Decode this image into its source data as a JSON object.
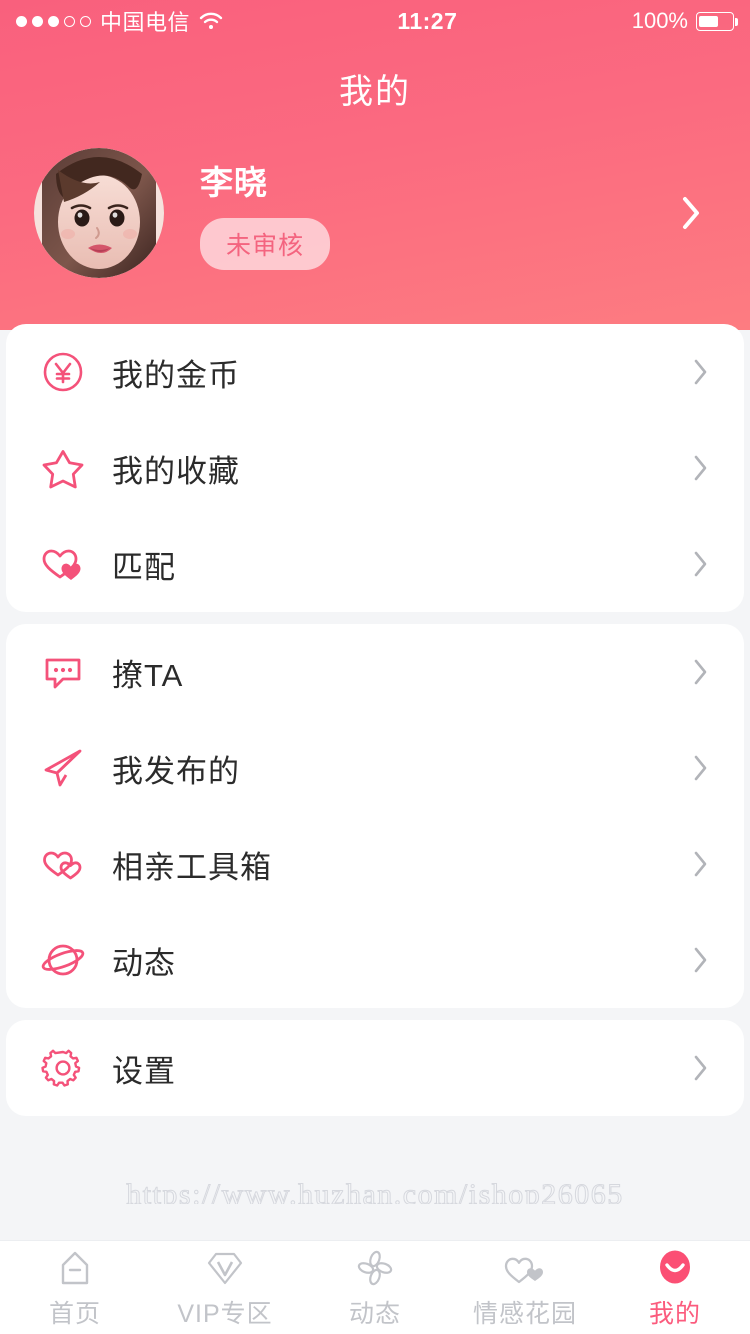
{
  "theme": {
    "header_gradient_top": "#f9607d",
    "header_gradient_bottom": "#fd7c81",
    "accent_pink": "#f4527a",
    "tab_active_pink": "#fb5b7d",
    "tab_inactive_gray": "#c2c4c9",
    "card_bg": "#ffffff",
    "page_bg": "#f4f5f7"
  },
  "status_bar": {
    "signal_dots": [
      "filled",
      "filled",
      "filled",
      "hollow",
      "hollow"
    ],
    "carrier": "中国电信",
    "wifi_icon": "wifi-icon",
    "time": "11:27",
    "battery_percent": "100%",
    "battery_icon": "battery-full-icon"
  },
  "header": {
    "title": "我的",
    "profile": {
      "avatar_icon": "avatar",
      "name": "李晓",
      "badge": "未审核",
      "chevron_icon": "chevron-right-icon"
    }
  },
  "menu_groups": [
    {
      "group_name": "account-group",
      "items": [
        {
          "icon": "coin-yuan-icon",
          "label": "我的金币",
          "chevron_icon": "chevron-right-icon"
        },
        {
          "icon": "star-icon",
          "label": "我的收藏",
          "chevron_icon": "chevron-right-icon"
        },
        {
          "icon": "double-heart-filled-icon",
          "label": "匹配",
          "chevron_icon": "chevron-right-icon"
        }
      ]
    },
    {
      "group_name": "social-group",
      "items": [
        {
          "icon": "chat-bubble-icon",
          "label": "撩TA",
          "chevron_icon": "chevron-right-icon"
        },
        {
          "icon": "paper-plane-icon",
          "label": "我发布的",
          "chevron_icon": "chevron-right-icon"
        },
        {
          "icon": "double-heart-outline-icon",
          "label": "相亲工具箱",
          "chevron_icon": "chevron-right-icon"
        },
        {
          "icon": "planet-icon",
          "label": "动态",
          "chevron_icon": "chevron-right-icon"
        }
      ]
    },
    {
      "group_name": "settings-group",
      "items": [
        {
          "icon": "gear-icon",
          "label": "设置",
          "chevron_icon": "chevron-right-icon"
        }
      ]
    }
  ],
  "watermark": "https://www.huzhan.com/ishop26065",
  "tab_bar": {
    "tabs": [
      {
        "icon": "home-icon",
        "label": "首页",
        "active": false
      },
      {
        "icon": "vip-diamond-icon",
        "label": "VIP专区",
        "active": false
      },
      {
        "icon": "pinwheel-icon",
        "label": "动态",
        "active": false
      },
      {
        "icon": "two-hearts-icon",
        "label": "情感花园",
        "active": false
      },
      {
        "icon": "smile-face-icon",
        "label": "我的",
        "active": true
      }
    ]
  }
}
